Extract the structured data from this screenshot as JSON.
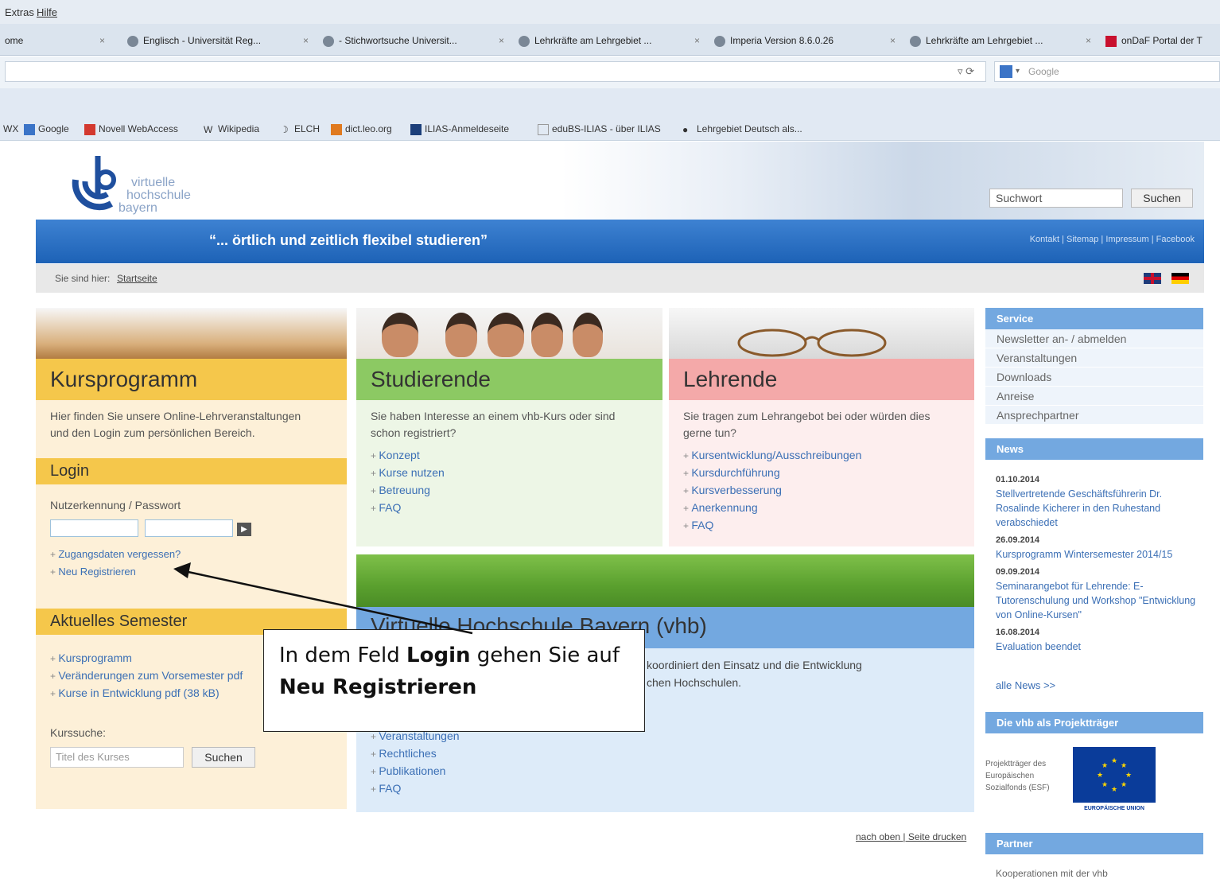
{
  "browser": {
    "menu": [
      "Extras",
      "Hilfe"
    ],
    "tabs": [
      {
        "label": "ome"
      },
      {
        "label": "Englisch - Universität Reg..."
      },
      {
        "label": "- Stichwortsuche Universit..."
      },
      {
        "label": "Lehrkräfte am Lehrgebiet ..."
      },
      {
        "label": "Imperia Version 8.6.0.26"
      },
      {
        "label": "Lehrkräfte am Lehrgebiet ..."
      },
      {
        "label": "onDaF Portal der T"
      }
    ],
    "search_engine": "Google",
    "bookmarks": [
      "WX",
      "Google",
      "Novell WebAccess",
      "Wikipedia",
      "ELCH",
      "dict.leo.org",
      "ILIAS-Anmeldeseite",
      "eduBS-ILIAS - über ILIAS",
      "Lehrgebiet Deutsch als..."
    ]
  },
  "site": {
    "logo_lines": [
      "virtuelle",
      "hochschule",
      "bayern"
    ],
    "search_placeholder": "Suchwort",
    "search_button": "Suchen",
    "slogan": "“... örtlich und zeitlich flexibel studieren”",
    "top_links": "Kontakt | Sitemap | Impressum | Facebook",
    "breadcrumb_label": "Sie sind hier:",
    "breadcrumb_link": "Startseite"
  },
  "kursprogramm": {
    "title": "Kursprogramm",
    "text": [
      "Hier finden Sie unsere Online-Lehrveranstaltungen",
      "und den Login zum persönlichen Bereich."
    ],
    "login_title": "Login",
    "login_label": "Nutzerkennung / Passwort",
    "login_links": [
      "Zugangsdaten vergessen?",
      "Neu Registrieren"
    ],
    "semester_title": "Aktuelles Semester",
    "semester_links": [
      "Kursprogramm",
      "Veränderungen zum Vorsemester pdf",
      "Kurse in Entwicklung pdf (38 kB)"
    ],
    "kurssuche_label": "Kurssuche:",
    "kurssuche_placeholder": "Titel des Kurses",
    "kurssuche_button": "Suchen"
  },
  "studierende": {
    "title": "Studierende",
    "text": [
      "Sie haben Interesse an einem vhb-Kurs oder sind",
      "schon registriert?"
    ],
    "links": [
      "Konzept",
      "Kurse nutzen",
      "Betreuung",
      "FAQ"
    ]
  },
  "lehrende": {
    "title": "Lehrende",
    "text": [
      "Sie tragen zum Lehrangebot bei oder würden dies",
      "gerne tun?"
    ],
    "links": [
      "Kursentwicklung/Ausschreibungen",
      "Kursdurchführung",
      "Kursverbesserung",
      "Anerkennung",
      "FAQ"
    ]
  },
  "vhb": {
    "title": "Virtuelle Hochschule Bayern (vhb)",
    "text": [
      "koordiniert den Einsatz und die Entwicklung",
      "chen Hochschulen."
    ],
    "links": [
      "Veranstaltungen",
      "Rechtliches",
      "Publikationen",
      "FAQ"
    ]
  },
  "callout": {
    "line1_pre": "In dem Feld ",
    "line1_bold": "Login",
    "line1_post": " gehen Sie auf",
    "line2_bold": "Neu Registrieren"
  },
  "sidebar": {
    "service_title": "Service",
    "service_items": [
      "Newsletter an- / abmelden",
      "Veranstaltungen",
      "Downloads",
      "Anreise",
      "Ansprechpartner"
    ],
    "news_title": "News",
    "news": [
      {
        "date": "01.10.2014",
        "text": "Stellvertretende Geschäftsführerin Dr. Rosalinde Kicherer in den Ruhestand verabschiedet"
      },
      {
        "date": "26.09.2014",
        "text": "Kursprogramm Wintersemester 2014/15"
      },
      {
        "date": "09.09.2014",
        "text": "Seminarangebot für Lehrende: E-Tutorenschulung und Workshop \"Entwicklung von Online-Kursen\""
      },
      {
        "date": "16.08.2014",
        "text": "Evaluation beendet"
      }
    ],
    "news_all": "alle News >>",
    "projekt_title": "Die vhb als Projektträger",
    "esf_text": "Projektträger des Europäischen Sozialfonds (ESF)",
    "eu_label": "EUROPÄISCHE UNION",
    "partner_title": "Partner",
    "partner_text": "Kooperationen mit der vhb"
  },
  "footer": {
    "links": "nach oben | Seite drucken"
  },
  "colors": {
    "accent_blue": "#1d62b6",
    "kurs_yellow": "#f5c74b",
    "stud_green": "#8cc963",
    "lehr_pink": "#f4a9a9",
    "side_blue": "#73a8e0"
  }
}
